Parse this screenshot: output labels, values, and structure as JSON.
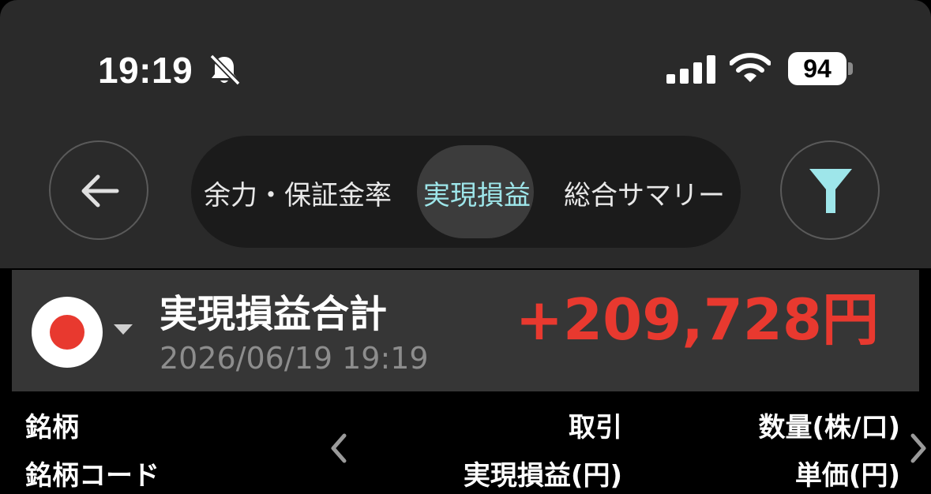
{
  "status_bar": {
    "time": "19:19",
    "battery": "94"
  },
  "nav": {
    "tabs": [
      {
        "label": "余力・保証金率",
        "active": false
      },
      {
        "label": "実現損益",
        "active": true
      },
      {
        "label": "総合サマリー",
        "active": false
      }
    ]
  },
  "summary": {
    "title": "実現損益合計",
    "datetime": "2026/06/19 19:19",
    "amount": "+209,728円"
  },
  "columns": {
    "symbol": "銘柄",
    "symbol_code": "銘柄コード",
    "trade": "取引",
    "realized_pl": "実現損益(円)",
    "quantity": "数量(株/口)",
    "unit_price": "単価(円)"
  },
  "colors": {
    "accent": "#9ee6ea",
    "gain": "#e8392f",
    "flag_red": "#e8392f"
  },
  "icons": {
    "back": "arrow-left-icon",
    "filter": "filter-icon",
    "mute": "bell-slash-icon"
  }
}
